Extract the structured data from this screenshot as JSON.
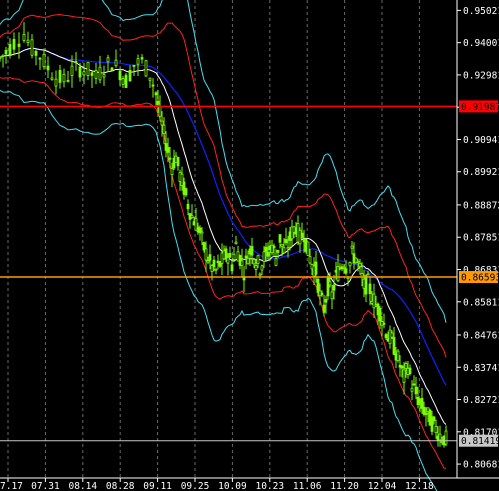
{
  "chart_data": {
    "type": "candlestick",
    "symbol_note": "",
    "ylim": [
      0.8062,
      0.9516
    ],
    "y_ticks": [
      "0.95021",
      "0.94001",
      "0.92981",
      "0.91961",
      "0.90941",
      "0.89921",
      "0.88872",
      "0.87851",
      "0.86831",
      "0.85811",
      "0.84761",
      "0.83741",
      "0.82721",
      "0.81701",
      "0.80681"
    ],
    "x_ticks": [
      "7.17",
      "07.31",
      "08.14",
      "08.28",
      "09.11",
      "09.25",
      "10.09",
      "10.23",
      "11.06",
      "11.20",
      "12.04",
      "12.18"
    ],
    "horizontal_lines": [
      {
        "label": "0.91987",
        "value": 0.91987,
        "color": "#ff0000"
      },
      {
        "label": "0.86593",
        "value": 0.86593,
        "color": "#ff9900"
      },
      {
        "label": "0.81419",
        "value": 0.81419,
        "color": "#c8c8c8"
      }
    ],
    "candle_color": "#7cfc00",
    "grid": true,
    "indicator_colors": {
      "outer_band": "#40e0f0",
      "inner_band": "#ff2020",
      "slow_ma": "#1020ff",
      "fast_ma": "#ffffff"
    },
    "path_segments": [
      [
        0,
        0.935
      ],
      [
        6,
        0.937
      ],
      [
        14,
        0.94
      ],
      [
        24,
        0.943
      ],
      [
        32,
        0.938
      ],
      [
        40,
        0.936
      ],
      [
        48,
        0.932
      ],
      [
        56,
        0.929
      ],
      [
        64,
        0.928
      ],
      [
        72,
        0.931
      ],
      [
        80,
        0.932
      ],
      [
        88,
        0.931
      ],
      [
        96,
        0.929
      ],
      [
        104,
        0.932
      ],
      [
        112,
        0.934
      ],
      [
        120,
        0.931
      ],
      [
        126,
        0.928
      ],
      [
        134,
        0.933
      ],
      [
        142,
        0.934
      ],
      [
        150,
        0.93
      ],
      [
        156,
        0.924
      ],
      [
        160,
        0.917
      ],
      [
        164,
        0.911
      ],
      [
        168,
        0.906
      ],
      [
        172,
        0.901
      ],
      [
        176,
        0.904
      ],
      [
        180,
        0.898
      ],
      [
        184,
        0.894
      ],
      [
        188,
        0.889
      ],
      [
        192,
        0.885
      ],
      [
        196,
        0.883
      ],
      [
        200,
        0.88
      ],
      [
        204,
        0.875
      ],
      [
        208,
        0.872
      ],
      [
        212,
        0.869
      ],
      [
        216,
        0.868
      ],
      [
        220,
        0.87
      ],
      [
        224,
        0.872
      ],
      [
        228,
        0.873
      ],
      [
        232,
        0.87
      ],
      [
        236,
        0.876
      ],
      [
        240,
        0.872
      ],
      [
        244,
        0.868
      ],
      [
        248,
        0.873
      ],
      [
        252,
        0.875
      ],
      [
        256,
        0.871
      ],
      [
        260,
        0.869
      ],
      [
        264,
        0.872
      ],
      [
        268,
        0.874
      ],
      [
        272,
        0.876
      ],
      [
        276,
        0.872
      ],
      [
        280,
        0.878
      ],
      [
        284,
        0.874
      ],
      [
        288,
        0.876
      ],
      [
        292,
        0.88
      ],
      [
        296,
        0.882
      ],
      [
        300,
        0.878
      ],
      [
        304,
        0.88
      ],
      [
        308,
        0.874
      ],
      [
        312,
        0.87
      ],
      [
        316,
        0.868
      ],
      [
        320,
        0.86
      ],
      [
        324,
        0.856
      ],
      [
        328,
        0.863
      ],
      [
        332,
        0.86
      ],
      [
        336,
        0.866
      ],
      [
        340,
        0.869
      ],
      [
        344,
        0.871
      ],
      [
        348,
        0.868
      ],
      [
        352,
        0.873
      ],
      [
        356,
        0.872
      ],
      [
        360,
        0.868
      ],
      [
        364,
        0.863
      ],
      [
        368,
        0.864
      ],
      [
        372,
        0.86
      ],
      [
        376,
        0.857
      ],
      [
        380,
        0.855
      ],
      [
        384,
        0.851
      ],
      [
        388,
        0.847
      ],
      [
        392,
        0.846
      ],
      [
        396,
        0.842
      ],
      [
        400,
        0.838
      ],
      [
        404,
        0.834
      ],
      [
        408,
        0.838
      ],
      [
        412,
        0.832
      ],
      [
        416,
        0.829
      ],
      [
        420,
        0.826
      ],
      [
        424,
        0.824
      ],
      [
        428,
        0.822
      ],
      [
        432,
        0.82
      ],
      [
        436,
        0.818
      ],
      [
        440,
        0.816
      ],
      [
        444,
        0.815
      ],
      [
        448,
        0.814
      ]
    ]
  }
}
